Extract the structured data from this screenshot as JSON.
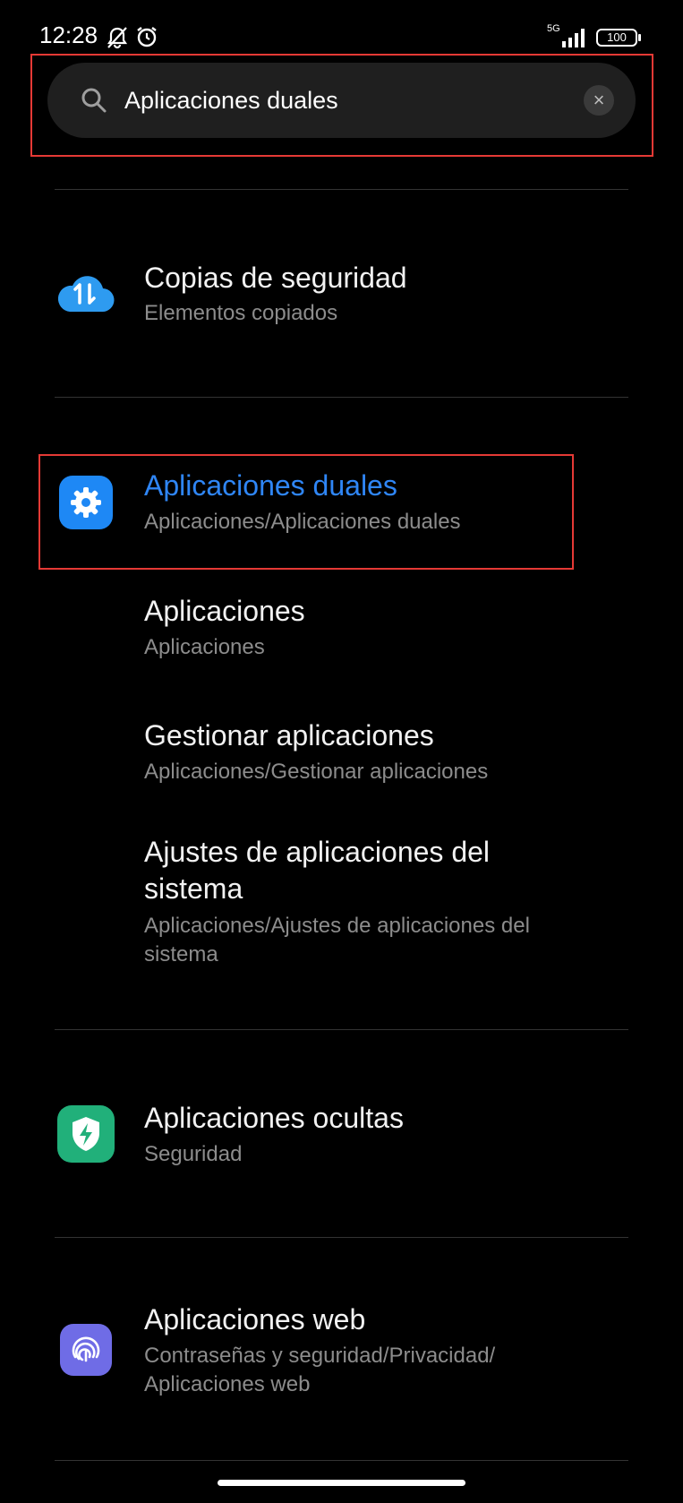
{
  "status_bar": {
    "time": "12:28",
    "network": "5G",
    "battery": "100",
    "icons": [
      "bell-off-icon",
      "alarm-icon",
      "signal-icon",
      "battery-icon"
    ]
  },
  "search": {
    "value": "Aplicaciones duales",
    "icon": "search-icon",
    "clear_icon": "close-icon"
  },
  "results": [
    {
      "title": "Copias de seguridad",
      "subtitle": "Elementos copiados",
      "icon": "cloud-sync-icon",
      "icon_color": "#2e9bf0"
    },
    {
      "title": "Aplicaciones duales",
      "subtitle": "Aplicaciones/Aplicaciones duales",
      "icon": "gear-icon",
      "icon_color": "#1e88f5",
      "highlighted": true
    },
    {
      "title": "Aplicaciones",
      "subtitle": "Aplicaciones"
    },
    {
      "title": "Gestionar aplicaciones",
      "subtitle": "Aplicaciones/Gestionar aplicaciones"
    },
    {
      "title_line1": "Ajustes de aplicaciones del",
      "title_line2": "sistema",
      "subtitle_line1": "Aplicaciones/Ajustes de aplicaciones del",
      "subtitle_line2": "sistema"
    },
    {
      "title": "Aplicaciones ocultas",
      "subtitle": "Seguridad",
      "icon": "shield-bolt-icon",
      "icon_color": "#21b07a"
    },
    {
      "title": "Aplicaciones web",
      "subtitle_line1": "Contraseñas y seguridad/Privacidad/",
      "subtitle_line2": "Aplicaciones web",
      "icon": "fingerprint-icon",
      "icon_color": "#6f6ce6"
    }
  ],
  "colors": {
    "accent": "#2f86f6",
    "highlight_border": "#e53935",
    "background": "#000000"
  }
}
